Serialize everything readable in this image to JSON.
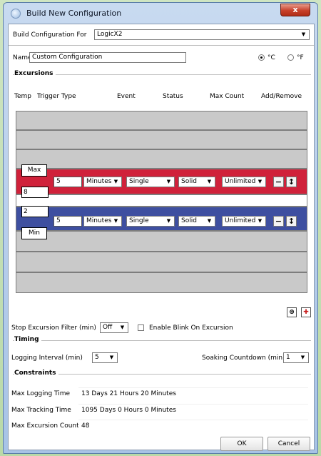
{
  "window": {
    "title": "Build New Configuration",
    "close_glyph": "x"
  },
  "build_for": {
    "label": "Build Configuration For",
    "value": "LogicX2"
  },
  "name": {
    "label": "Name",
    "value": "Custom Configuration"
  },
  "units": {
    "celsius": "°C",
    "fahrenheit": "°F",
    "selected": "celsius"
  },
  "excursions": {
    "section_label": "Excursions",
    "headers": [
      "Temp",
      "Trigger Type",
      "Event",
      "Status",
      "Max Count",
      "Add/Remove"
    ],
    "max": {
      "label": "Max",
      "temp": "8",
      "trigger_value": "5",
      "trigger_unit": "Minutes",
      "event": "Single",
      "status": "Solid",
      "max_count": "Unlimited"
    },
    "min": {
      "label": "Min",
      "temp": "2",
      "trigger_value": "5",
      "trigger_unit": "Minutes",
      "event": "Single",
      "status": "Solid",
      "max_count": "Unlimited"
    },
    "band_colors": {
      "max": "#d0213a",
      "min": "#3e4fa0"
    }
  },
  "filter": {
    "label": "Stop Excursion Filter (min)",
    "value": "Off",
    "blink_label": "Enable Blink On Excursion"
  },
  "timing": {
    "section_label": "Timing",
    "logging_label": "Logging Interval (min)",
    "logging_value": "5",
    "soaking_label": "Soaking Countdown (min)",
    "soaking_value": "1"
  },
  "constraints": {
    "section_label": "Constraints",
    "rows": [
      {
        "label": "Max Logging Time",
        "value": "13 Days 21 Hours 20 Minutes"
      },
      {
        "label": "Max Tracking Time",
        "value": "1095 Days 0 Hours 0 Minutes"
      },
      {
        "label": "Max Excursion Count",
        "value": "48"
      }
    ]
  },
  "buttons": {
    "ok": "OK",
    "cancel": "Cancel"
  },
  "icons": {
    "dropdown": "▼",
    "remove": "−",
    "move": "↕"
  }
}
